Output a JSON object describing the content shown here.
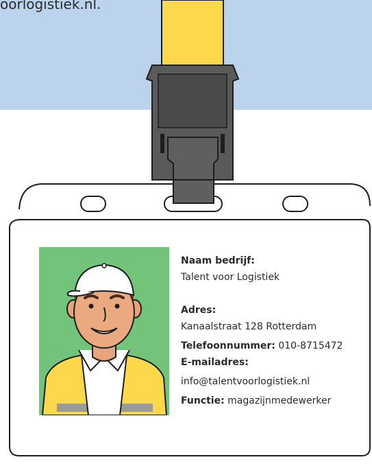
{
  "intro": {
    "text_fragment": "oorlogistiek.nl."
  },
  "card": {
    "company_label": "Naam bedrijf:",
    "company_value": "Talent voor Logistiek",
    "address_label": "Adres:",
    "address_value": "Kanaalstraat 128 Rotterdam",
    "phone_label": "Telefoonnummer:",
    "phone_value": "010-8715472",
    "email_label": "E-mailadres:",
    "email_value": "info@talentvoorlogistiek.nl",
    "role_label": "Functie:",
    "role_value": "magazijnmedewerker"
  },
  "colors": {
    "band": "#bcd3ee",
    "strap": "#fdd84b",
    "clip": "#5a5a5a",
    "photo_bg": "#74c37a",
    "vest": "#fdd84b"
  },
  "icons": {
    "badge_clip": "badge-clip-illustration",
    "person_photo": "warehouse-worker-portrait"
  }
}
